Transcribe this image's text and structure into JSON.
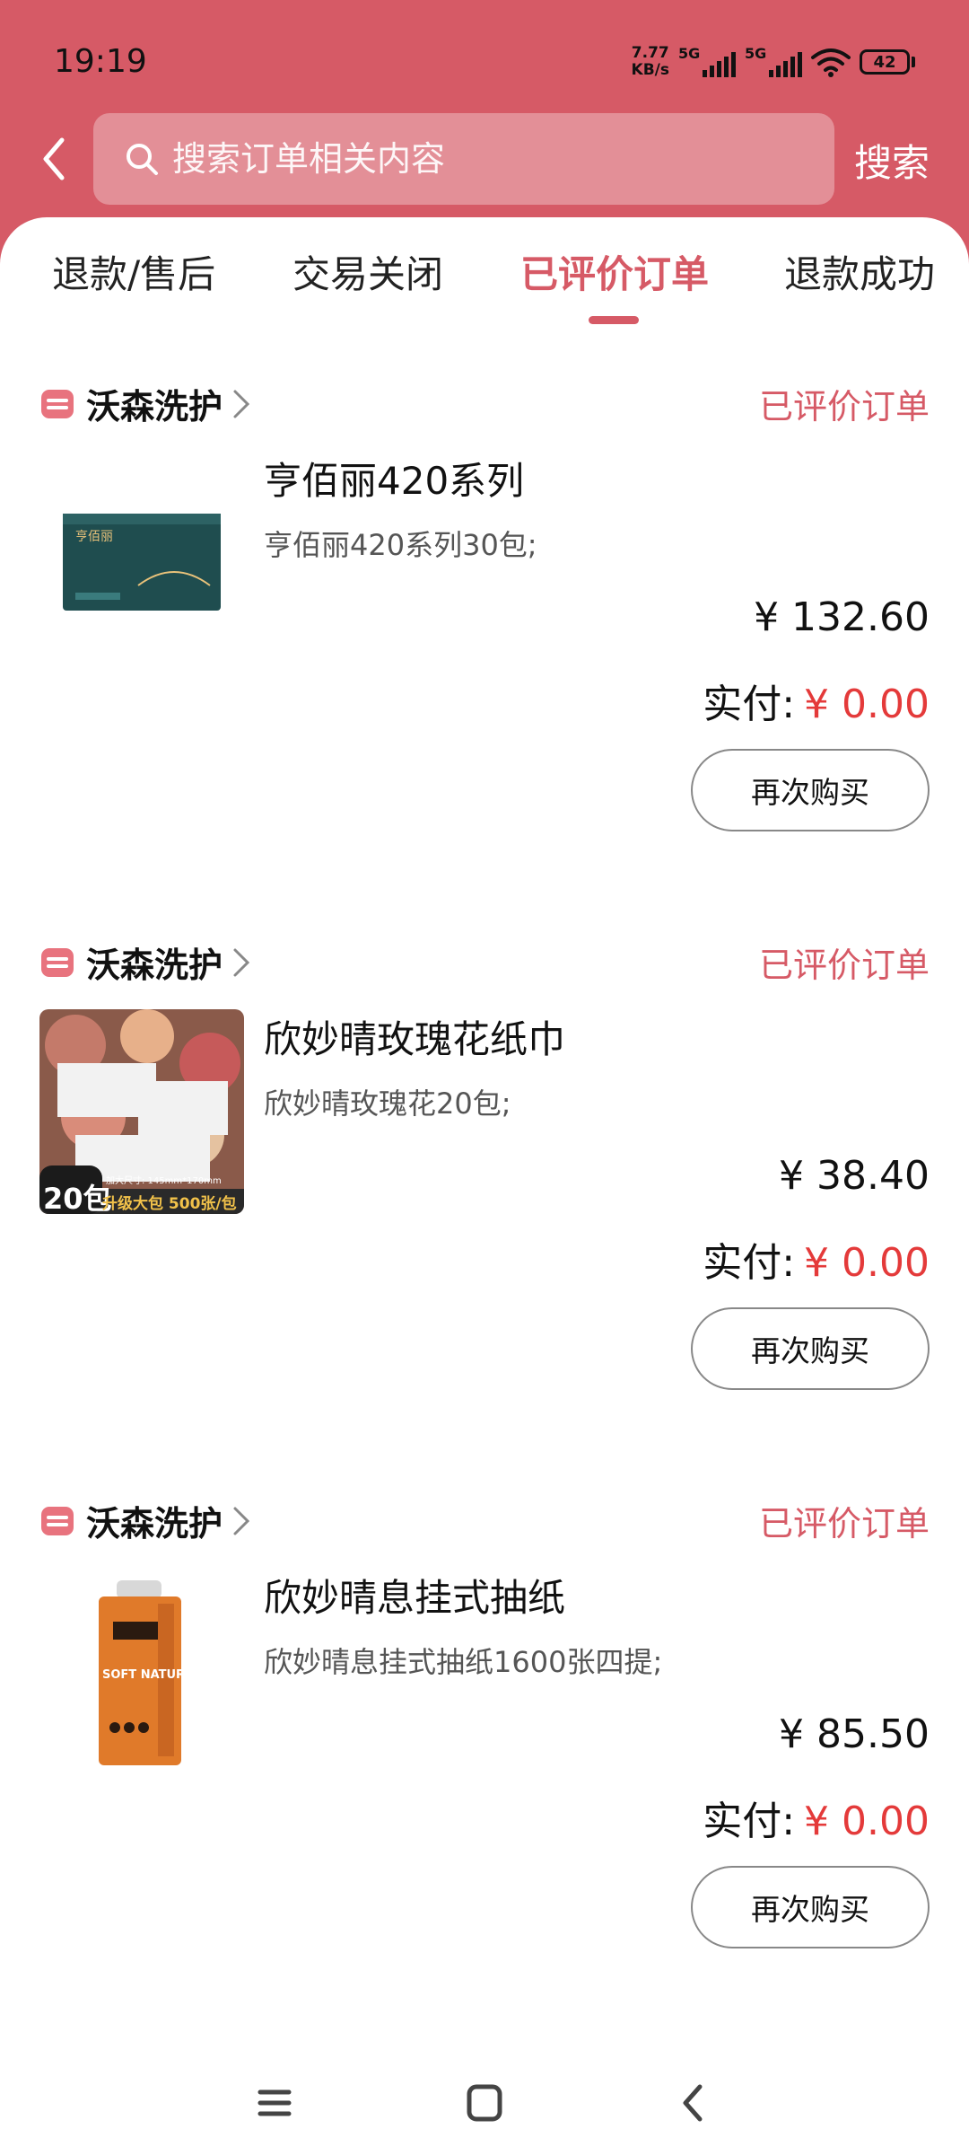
{
  "status_bar": {
    "time": "19:19",
    "net_speed_value": "7.77",
    "net_speed_unit": "KB/s",
    "sim1_label": "5G",
    "sim2_label": "5G",
    "battery": "42"
  },
  "header": {
    "search_placeholder": "搜索订单相关内容",
    "search_button": "搜索"
  },
  "tabs": [
    {
      "label": "退款/售后",
      "active": false
    },
    {
      "label": "交易关闭",
      "active": false
    },
    {
      "label": "已评价订单",
      "active": true
    },
    {
      "label": "退款成功",
      "active": false
    }
  ],
  "orders": [
    {
      "shop": "沃森洗护",
      "status": "已评价订单",
      "title": "亨佰丽420系列",
      "spec": "亨佰丽420系列30包;",
      "price": "¥ 132.60",
      "paid_label": "实付:",
      "paid_value": "¥ 0.00",
      "button": "再次购买"
    },
    {
      "shop": "沃森洗护",
      "status": "已评价订单",
      "title": "欣妙晴玫瑰花纸巾",
      "spec": "欣妙晴玫瑰花20包;",
      "price": "¥ 38.40",
      "paid_label": "实付:",
      "paid_value": "¥ 0.00",
      "button": "再次购买",
      "image_text": {
        "count": "20包",
        "banner": "升级大包 500张/包",
        "size": "加大尺寸: 145mm*170mm"
      }
    },
    {
      "shop": "沃森洗护",
      "status": "已评价订单",
      "title": "欣妙晴息挂式抽纸",
      "spec": "欣妙晴息挂式抽纸1600张四提;",
      "price": "¥ 85.50",
      "paid_label": "实付:",
      "paid_value": "¥ 0.00",
      "button": "再次购买",
      "image_text": {
        "brand": "SOFT NATURE"
      }
    }
  ],
  "colors": {
    "header_bg": "#d65a66",
    "accent": "#d65a66",
    "paid_red": "#e43a3a"
  },
  "icons": [
    "back-arrow-icon",
    "search-icon",
    "shop-icon",
    "chevron-right-icon",
    "menu-icon",
    "home-icon",
    "back-icon"
  ]
}
